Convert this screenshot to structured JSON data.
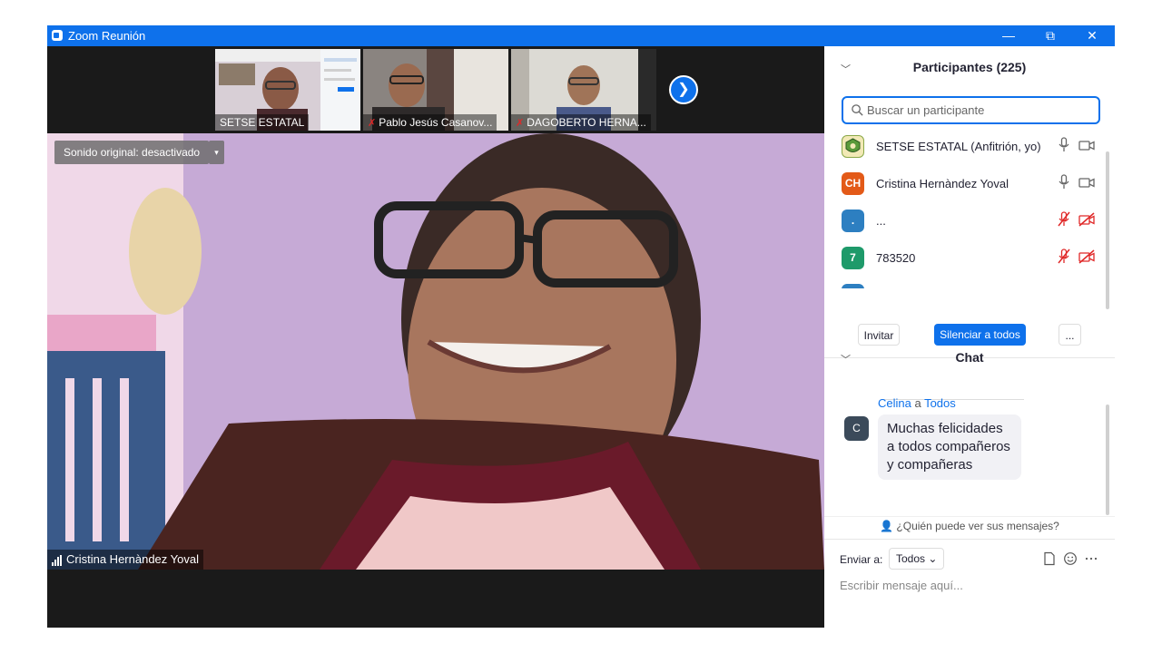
{
  "window": {
    "title": "Zoom Reunión",
    "controls": {
      "minimize": "—",
      "restore": "⧉",
      "close": "✕"
    }
  },
  "thumbnails": [
    {
      "name": "SETSE ESTATAL",
      "muted": false,
      "bg": "#d9d4dc"
    },
    {
      "name": "Pablo Jesús Casanov...",
      "muted": true,
      "bg": "#6a6a6a"
    },
    {
      "name": "DAGOBERTO HERNA...",
      "muted": true,
      "bg": "#d4d2cd"
    }
  ],
  "next_page_icon": "chevron-right-icon",
  "main_video": {
    "sound_button": "Sonido original: desactivado",
    "speaker_name": "Cristina Hernàndez Yoval"
  },
  "participants_panel": {
    "title": "Participantes (225)",
    "search_placeholder": "Buscar un participante",
    "participants": [
      {
        "avatar": "",
        "avatar_color": "#5a9a3a",
        "name": "SETSE ESTATAL (Anfitrión, yo)",
        "mic": "on",
        "camera": "on"
      },
      {
        "avatar": "CH",
        "avatar_color": "#e35a18",
        "name": "Cristina Hernàndez Yoval",
        "mic": "on",
        "camera": "on"
      },
      {
        "avatar": ".",
        "avatar_color": "#2d7fc1",
        "name": "...",
        "mic": "muted",
        "camera": "off"
      },
      {
        "avatar": "7",
        "avatar_color": "#1e9a6a",
        "name": "783520",
        "mic": "muted",
        "camera": "off"
      }
    ],
    "buttons": {
      "invite": "Invitar",
      "mute_all": "Silenciar a todos",
      "more": "..."
    }
  },
  "chat": {
    "title": "Chat",
    "message": {
      "sender": "Celina",
      "recipient_sep": " a ",
      "recipient": "Todos",
      "avatar": "C",
      "text": "Muchas felicidades a todos compañeros y compañeras"
    },
    "who_can_see": "¿Quién puede ver sus mensajes?",
    "send_to_label": "Enviar a:",
    "send_to_value": "Todos",
    "compose_placeholder": "Escribir mensaje aquí..."
  },
  "colors": {
    "accent": "#0e71eb",
    "muted_red": "#e02828"
  }
}
